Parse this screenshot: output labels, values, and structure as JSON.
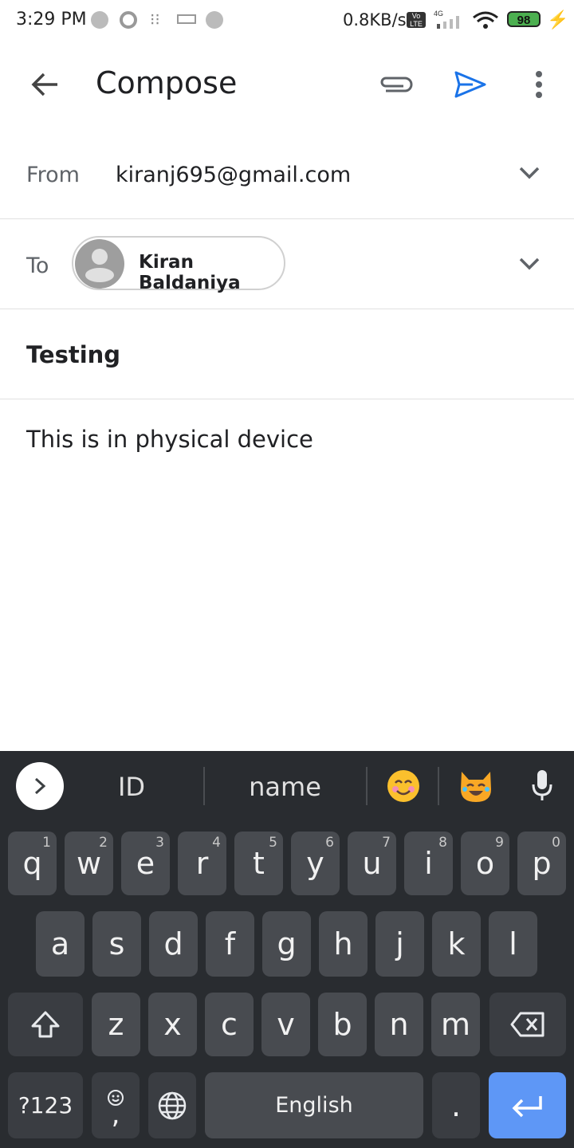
{
  "status_bar": {
    "time": "3:29 PM",
    "speed": "0.8KB/s",
    "volte": "Vo LTE",
    "network": "4G",
    "battery": "98"
  },
  "app_bar": {
    "title": "Compose"
  },
  "from": {
    "label": "From",
    "value": "kiranj695@gmail.com"
  },
  "to": {
    "label": "To",
    "recipient": "Kiran Baldaniya"
  },
  "subject": "Testing",
  "body": "This is in physical device",
  "keyboard": {
    "suggestions": [
      "ID",
      "name"
    ],
    "row1": [
      {
        "k": "q",
        "h": "1"
      },
      {
        "k": "w",
        "h": "2"
      },
      {
        "k": "e",
        "h": "3"
      },
      {
        "k": "r",
        "h": "4"
      },
      {
        "k": "t",
        "h": "5"
      },
      {
        "k": "y",
        "h": "6"
      },
      {
        "k": "u",
        "h": "7"
      },
      {
        "k": "i",
        "h": "8"
      },
      {
        "k": "o",
        "h": "9"
      },
      {
        "k": "p",
        "h": "0"
      }
    ],
    "row2": [
      "a",
      "s",
      "d",
      "f",
      "g",
      "h",
      "j",
      "k",
      "l"
    ],
    "row3": [
      "z",
      "x",
      "c",
      "v",
      "b",
      "n",
      "m"
    ],
    "symbols_label": "?123",
    "comma": ",",
    "space_label": "English",
    "period": ".",
    "accent_color": "#5e97f6"
  }
}
